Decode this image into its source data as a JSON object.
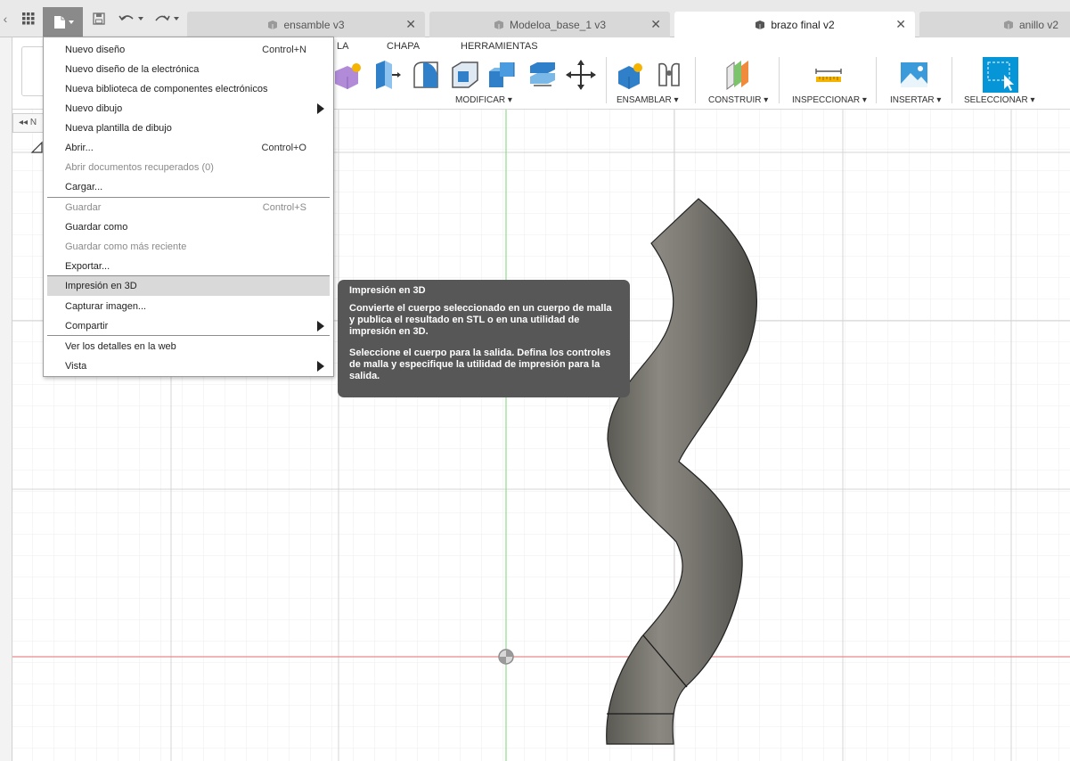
{
  "tabs": [
    {
      "label": "ensamble v3",
      "active": false
    },
    {
      "label": "Modeloa_base_1 v3",
      "active": false
    },
    {
      "label": "brazo final v2",
      "active": true
    },
    {
      "label": "anillo v2",
      "active": false
    }
  ],
  "ribbon": {
    "tabs": [
      "LA",
      "CHAPA",
      "HERRAMIENTAS"
    ],
    "groups": {
      "modificar": "MODIFICAR ▾",
      "ensamblar": "ENSAMBLAR ▾",
      "construir": "CONSTRUIR ▾",
      "inspeccionar": "INSPECCIONAR ▾",
      "insertar": "INSERTAR ▾",
      "seleccionar": "SELECCIONAR ▾"
    }
  },
  "browser_stub": {
    "label": "◂◂ N"
  },
  "file_menu": {
    "items": [
      {
        "label": "Nuevo diseño",
        "shortcut": "Control+N",
        "disabled": false,
        "submenu": false
      },
      {
        "label": "Nuevo diseño de la electrónica",
        "shortcut": "",
        "disabled": false,
        "submenu": false
      },
      {
        "label": "Nueva biblioteca de componentes electrónicos",
        "shortcut": "",
        "disabled": false,
        "submenu": false
      },
      {
        "label": "Nuevo dibujo",
        "shortcut": "",
        "disabled": false,
        "submenu": true
      },
      {
        "label": "Nueva plantilla de dibujo",
        "shortcut": "",
        "disabled": false,
        "submenu": false
      },
      {
        "label": "Abrir...",
        "shortcut": "Control+O",
        "disabled": false,
        "submenu": false
      },
      {
        "label": "Abrir documentos recuperados (0)",
        "shortcut": "",
        "disabled": true,
        "submenu": false
      },
      {
        "label": "Cargar...",
        "shortcut": "",
        "disabled": false,
        "submenu": false
      },
      {
        "label": "Guardar",
        "shortcut": "Control+S",
        "disabled": true,
        "submenu": false
      },
      {
        "label": "Guardar como",
        "shortcut": "",
        "disabled": false,
        "submenu": false
      },
      {
        "label": "Guardar como más reciente",
        "shortcut": "",
        "disabled": true,
        "submenu": false
      },
      {
        "label": "Exportar...",
        "shortcut": "",
        "disabled": false,
        "submenu": false
      },
      {
        "label": "Impresión en 3D",
        "shortcut": "",
        "disabled": false,
        "submenu": false,
        "hover": true
      },
      {
        "label": "Capturar imagen...",
        "shortcut": "",
        "disabled": false,
        "submenu": false
      },
      {
        "label": "Compartir",
        "shortcut": "",
        "disabled": false,
        "submenu": true
      },
      {
        "label": "Ver los detalles en la web",
        "shortcut": "",
        "disabled": false,
        "submenu": false
      },
      {
        "label": "Vista",
        "shortcut": "",
        "disabled": false,
        "submenu": true
      }
    ]
  },
  "tooltip": {
    "title": "Impresión en 3D",
    "p1": "Convierte el cuerpo seleccionado en un cuerpo de malla y publica el resultado en STL o en una utilidad de impresión en 3D.",
    "p2": "Seleccione el cuerpo para la salida. Defina los controles de malla y especifique la utilidad de impresión para la salida."
  },
  "colors": {
    "accent": "#0696d7",
    "file_btn": "#8a8a8a",
    "tooltip_bg": "#575757",
    "axis_x": "#e06666",
    "axis_y": "#7fd67f",
    "tube": "#6f6e68"
  }
}
